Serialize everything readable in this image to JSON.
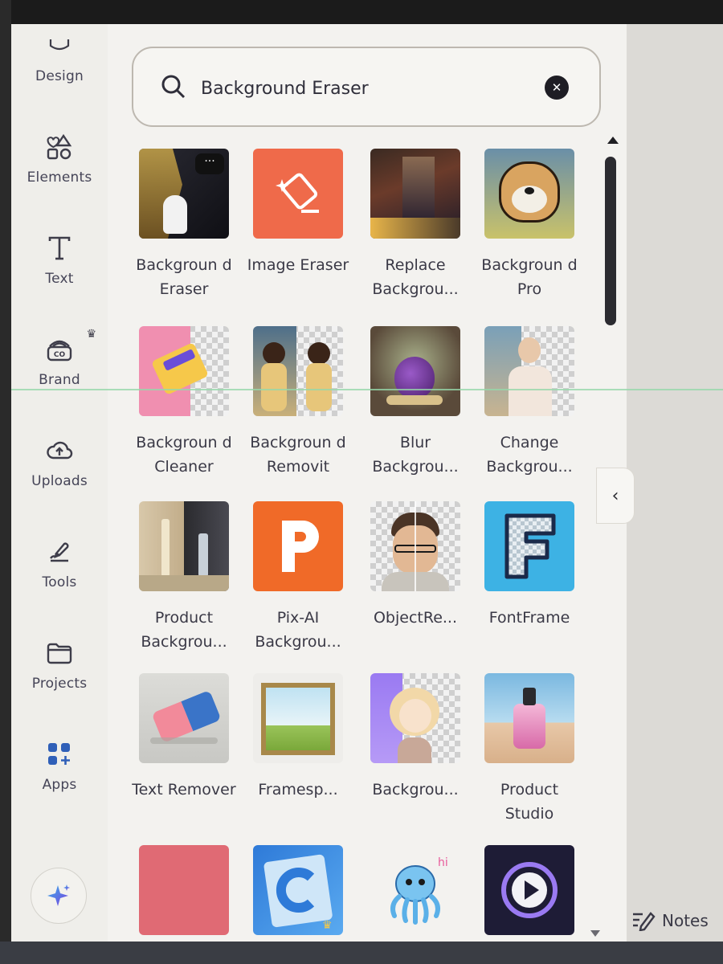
{
  "sidebar": {
    "items": [
      {
        "label": "Design",
        "icon": "design-icon"
      },
      {
        "label": "Elements",
        "icon": "elements-icon"
      },
      {
        "label": "Text",
        "icon": "text-icon"
      },
      {
        "label": "Brand",
        "icon": "brand-icon"
      },
      {
        "label": "Uploads",
        "icon": "upload-icon"
      },
      {
        "label": "Tools",
        "icon": "tools-icon"
      },
      {
        "label": "Projects",
        "icon": "folder-icon"
      },
      {
        "label": "Apps",
        "icon": "apps-icon"
      }
    ],
    "magic_icon": "sparkle-icon",
    "brand_badge_icon": "crown-icon"
  },
  "search": {
    "value": "Background Eraser",
    "icon": "search-icon",
    "clear_icon": "close-icon"
  },
  "results": [
    {
      "name": "Backgroun d Eraser"
    },
    {
      "name": "Image Eraser"
    },
    {
      "name": "Replace Backgrou..."
    },
    {
      "name": "Backgroun d Pro"
    },
    {
      "name": "Backgroun d Cleaner"
    },
    {
      "name": "Backgroun d Removit"
    },
    {
      "name": "Blur Backgrou..."
    },
    {
      "name": "Change Backgrou..."
    },
    {
      "name": "Product Backgrou..."
    },
    {
      "name": "Pix-AI Backgrou..."
    },
    {
      "name": "ObjectRe..."
    },
    {
      "name": "FontFrame"
    },
    {
      "name": "Text Remover"
    },
    {
      "name": "Framesp..."
    },
    {
      "name": "Backgrou..."
    },
    {
      "name": "Product Studio"
    },
    {
      "name": ""
    },
    {
      "name": ""
    },
    {
      "name": ""
    },
    {
      "name": ""
    }
  ],
  "notes": {
    "label": "Notes",
    "icon": "notes-icon"
  },
  "colors": {
    "sidebar_bg": "#efeeea",
    "panel_bg": "#f3f2ef",
    "text": "#3a3946",
    "accent_orange": "#ef6a4a",
    "accent_blue": "#3db2e4"
  }
}
